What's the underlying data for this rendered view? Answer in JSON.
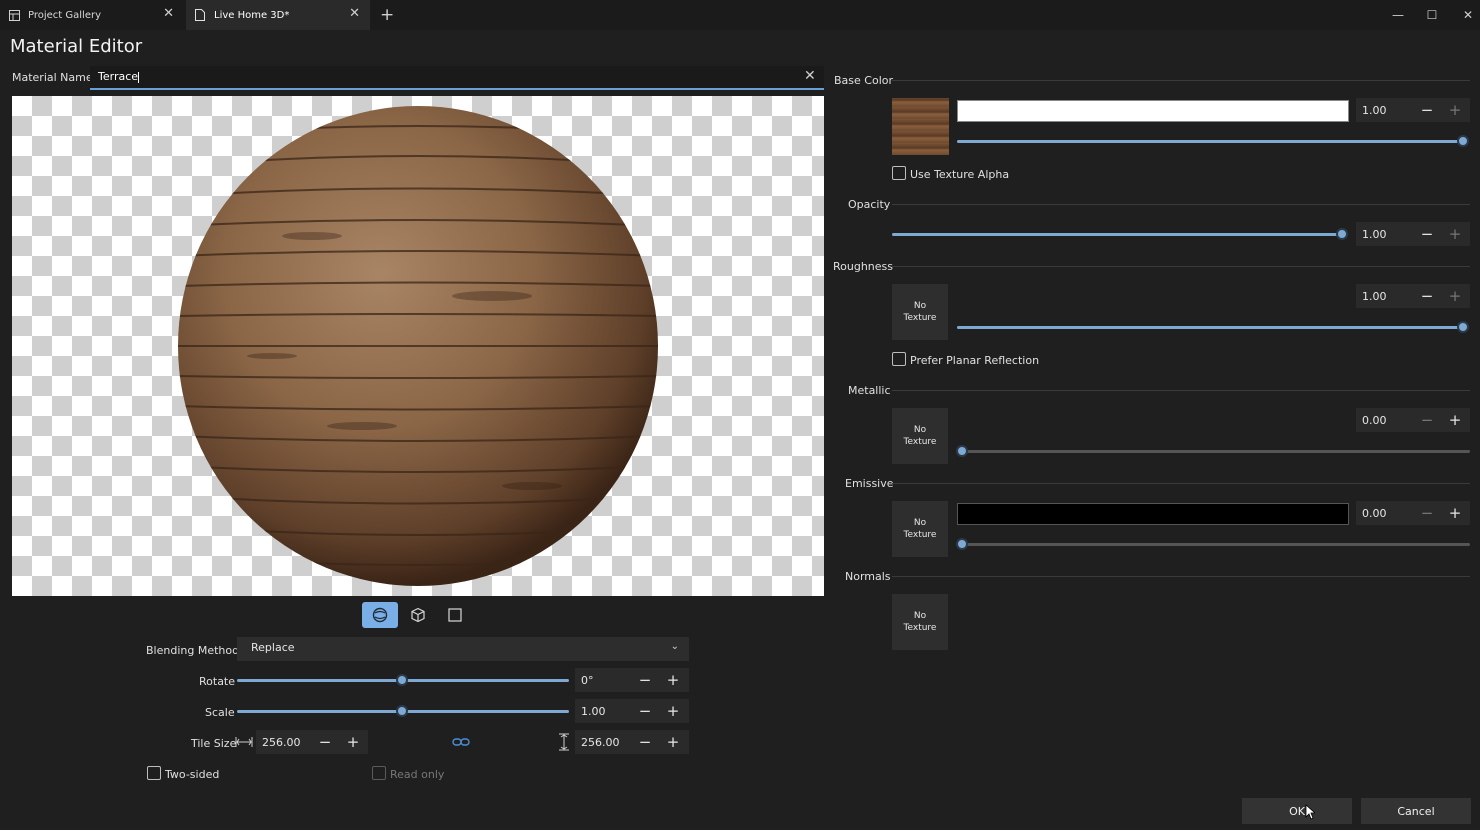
{
  "tabs": [
    {
      "label": "Project Gallery"
    },
    {
      "label": "Live Home 3D*"
    }
  ],
  "page_title": "Material Editor",
  "material_name": {
    "label": "Material Name",
    "value": "Terrace"
  },
  "preview": {
    "view_modes": [
      "sphere-view",
      "cube-view",
      "plane-view"
    ],
    "active": "sphere-view"
  },
  "blending": {
    "label": "Blending Method",
    "value": "Replace"
  },
  "rotate": {
    "label": "Rotate",
    "value": "0°",
    "fraction": 0.5
  },
  "scale": {
    "label": "Scale",
    "value": "1.00",
    "fraction": 0.5
  },
  "tile_size": {
    "label": "Tile Size",
    "width": "256.00",
    "height": "256.00"
  },
  "two_sided": {
    "label": "Two-sided",
    "checked": false
  },
  "read_only": {
    "label": "Read only",
    "checked": false
  },
  "base_color": {
    "label": "Base Color",
    "value": "1.00",
    "fraction": 1.0,
    "color": "#ffffff",
    "use_texture_alpha": "Use Texture Alpha"
  },
  "opacity": {
    "label": "Opacity",
    "value": "1.00",
    "fraction": 1.0
  },
  "roughness": {
    "label": "Roughness",
    "value": "1.00",
    "fraction": 1.0,
    "texture": "No Texture",
    "prefer_planar": "Prefer Planar Reflection"
  },
  "metallic": {
    "label": "Metallic",
    "value": "0.00",
    "fraction": 0.0,
    "texture": "No Texture"
  },
  "emissive": {
    "label": "Emissive",
    "value": "0.00",
    "fraction": 0.0,
    "texture": "No Texture",
    "color": "#000000"
  },
  "normals": {
    "label": "Normals",
    "texture": "No Texture"
  },
  "buttons": {
    "ok": "OK",
    "cancel": "Cancel"
  },
  "colors": {
    "accent": "#79aee6",
    "background": "#1f1f1f"
  }
}
